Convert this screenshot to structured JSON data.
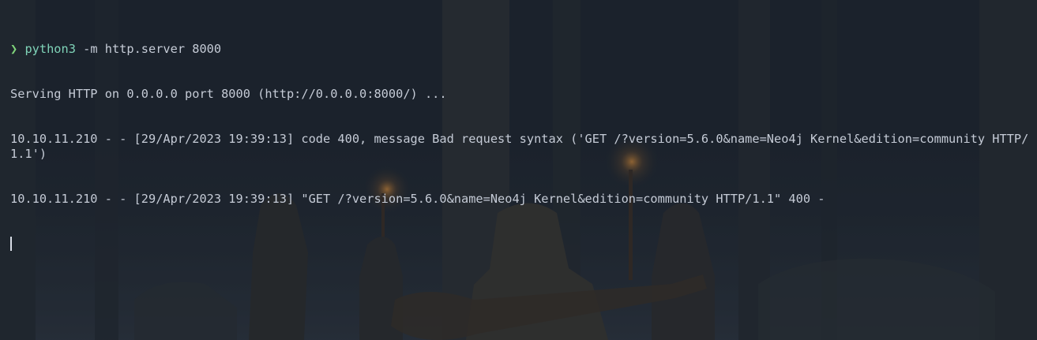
{
  "prompt": {
    "symbol": "❯",
    "command": "python3",
    "args": " -m http.server 8000"
  },
  "output": [
    "Serving HTTP on 0.0.0.0 port 8000 (http://0.0.0.0:8000/) ...",
    "10.10.11.210 - - [29/Apr/2023 19:39:13] code 400, message Bad request syntax ('GET /?version=5.6.0&name=Neo4j Kernel&edition=community HTTP/1.1')",
    "10.10.11.210 - - [29/Apr/2023 19:39:13] \"GET /?version=5.6.0&name=Neo4j Kernel&edition=community HTTP/1.1\" 400 -"
  ],
  "colors": {
    "prompt_arrow": "#7fd37a",
    "command": "#7fd3b8",
    "text": "#c5cbd6",
    "background": "#1c222c"
  }
}
